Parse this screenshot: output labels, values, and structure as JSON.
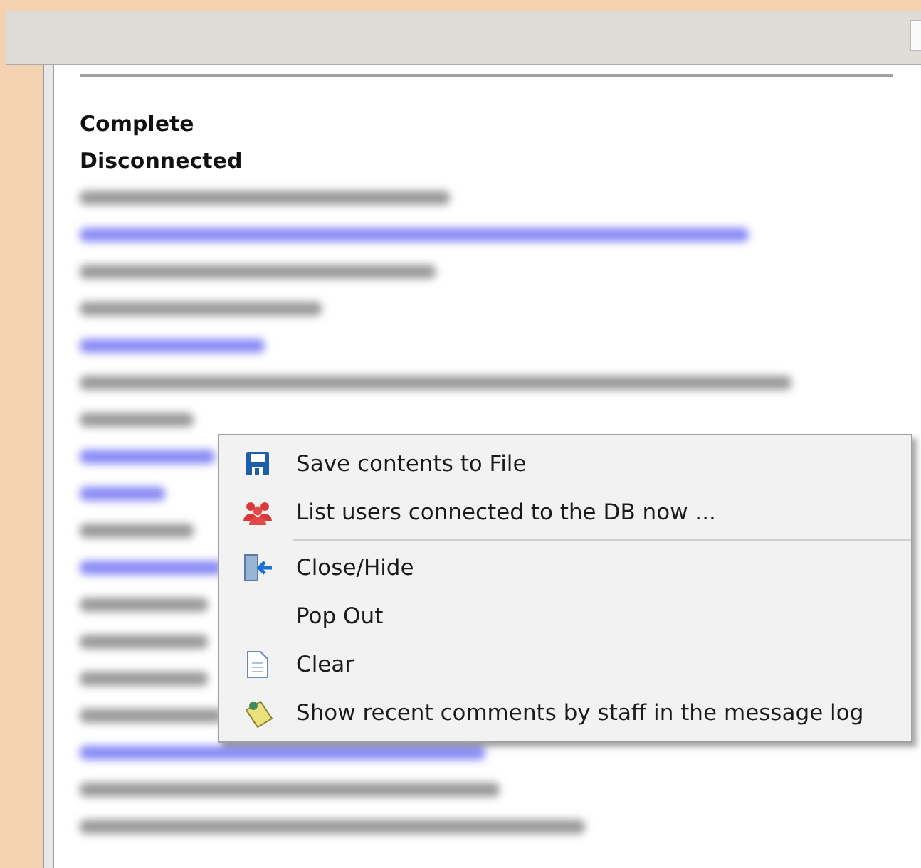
{
  "log": {
    "status_lines": [
      "Complete",
      "Disconnected"
    ],
    "redacted_lines": [
      {
        "kind": "text"
      },
      {
        "kind": "link"
      },
      {
        "kind": "text"
      },
      {
        "kind": "text"
      },
      {
        "kind": "link"
      },
      {
        "kind": "text"
      },
      {
        "kind": "text"
      },
      {
        "kind": "link"
      },
      {
        "kind": "link"
      },
      {
        "kind": "text"
      },
      {
        "kind": "link"
      },
      {
        "kind": "text"
      },
      {
        "kind": "text"
      },
      {
        "kind": "text"
      },
      {
        "kind": "text"
      },
      {
        "kind": "link"
      },
      {
        "kind": "text"
      },
      {
        "kind": "text"
      }
    ]
  },
  "context_menu": {
    "items": [
      {
        "kind": "item",
        "label": "Save contents to File"
      },
      {
        "kind": "item",
        "label": "List users connected to the DB now ..."
      },
      {
        "kind": "separator"
      },
      {
        "kind": "item",
        "label": "Close/Hide"
      },
      {
        "kind": "item",
        "label": "Pop Out"
      },
      {
        "kind": "item",
        "label": "Clear"
      },
      {
        "kind": "item",
        "label": "Show recent comments by staff in the message log"
      }
    ]
  }
}
